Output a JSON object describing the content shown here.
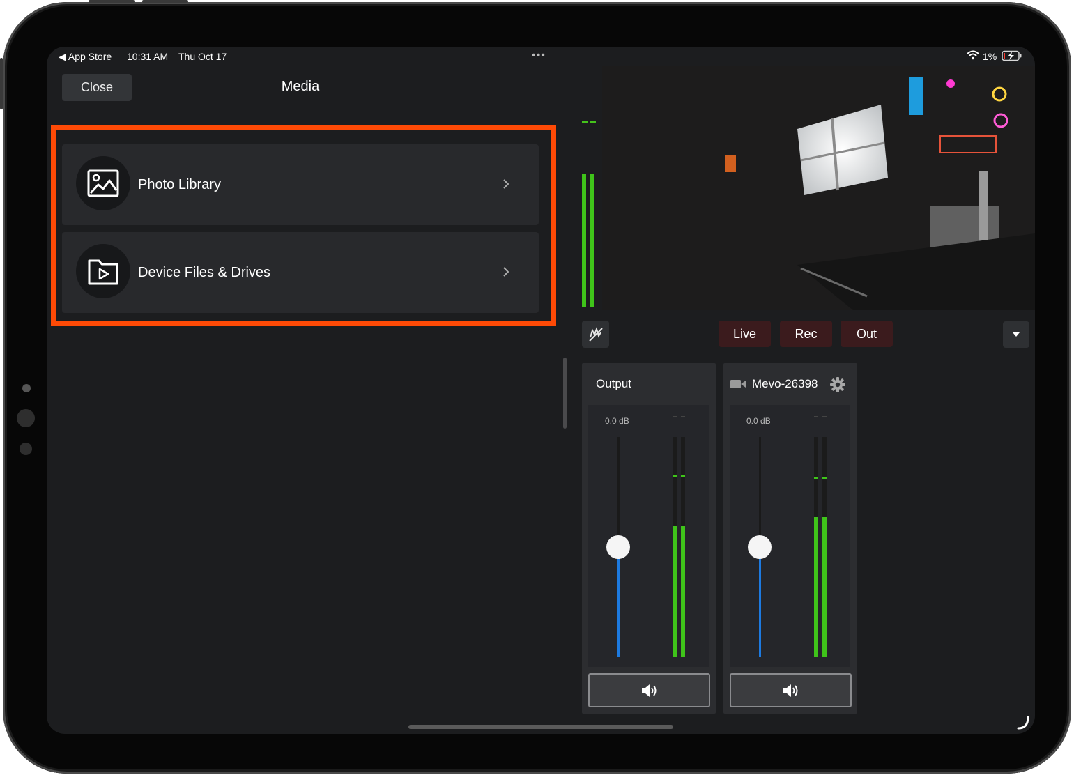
{
  "status_bar": {
    "back_app": "◀ App Store",
    "time": "10:31 AM",
    "date": "Thu Oct 17",
    "more": "•••",
    "battery": "1%"
  },
  "media_panel": {
    "close_label": "Close",
    "title": "Media",
    "items": [
      {
        "label": "Photo Library",
        "icon": "photo-icon"
      },
      {
        "label": "Device Files & Drives",
        "icon": "folder-play-icon"
      }
    ]
  },
  "controls": {
    "live_label": "Live",
    "rec_label": "Rec",
    "out_label": "Out"
  },
  "audio_mixer": {
    "strips": [
      {
        "name": "Output",
        "gain": "0.0 dB",
        "fader_level": 0.5,
        "meter_level": 0.6
      },
      {
        "name": "Mevo-26398",
        "gain": "0.0 dB",
        "fader_level": 0.5,
        "meter_level": 0.64
      }
    ]
  },
  "colors": {
    "highlight": "#fe4a06",
    "meter_green": "#3fc41a",
    "fader_blue": "#1d7ae0",
    "button_red": "#3b1b1d"
  }
}
